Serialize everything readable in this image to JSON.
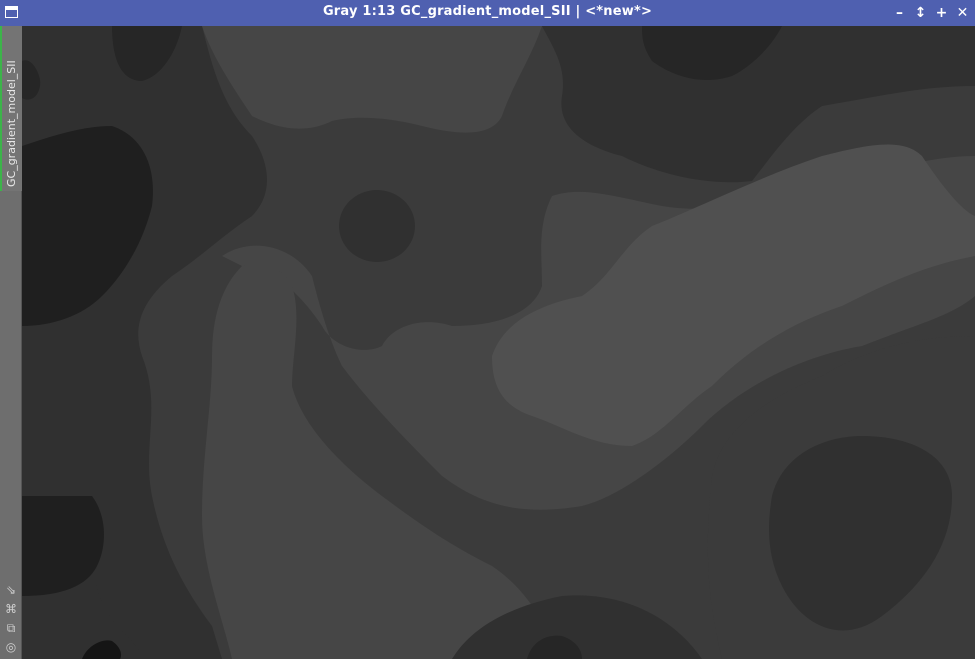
{
  "window": {
    "title": "Gray 1:13 GC_gradient_model_SII | <*new*>",
    "controls": {
      "minimize": "–",
      "shade": "↕",
      "maximize": "+",
      "close": "✕"
    }
  },
  "sidebar": {
    "tab_label": "GC_gradient_model_SII",
    "tab_accent": "#3cb44a",
    "tools": [
      {
        "icon": "fit-view-icon",
        "glyph": "⇘"
      },
      {
        "icon": "zoom-fit-icon",
        "glyph": "⌘"
      },
      {
        "icon": "clone-icon",
        "glyph": "⧉"
      },
      {
        "icon": "settings-icon",
        "glyph": "◎"
      }
    ]
  },
  "image": {
    "content": "gradient model contour levels",
    "levels": [
      "#1a1a1a",
      "#262626",
      "#303030",
      "#3b3b3b",
      "#464646",
      "#505050"
    ]
  },
  "colors": {
    "titlebar": "#4f60b0",
    "sidebar": "#6e6e6e"
  }
}
